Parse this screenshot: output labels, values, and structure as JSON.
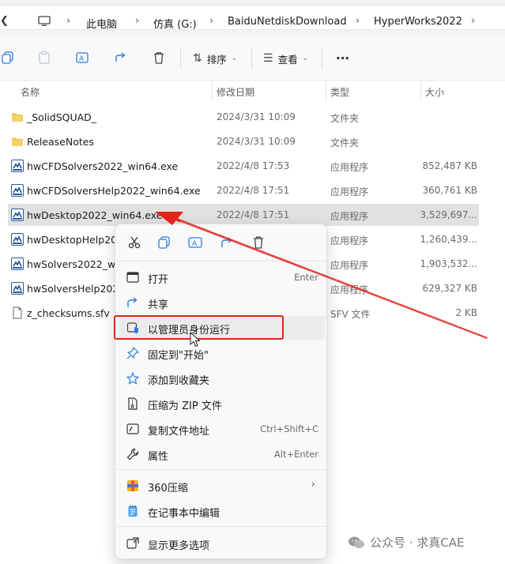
{
  "breadcrumb": [
    "此电脑",
    "仿真 (G:)",
    "BaiduNetdiskDownload",
    "HyperWorks2022"
  ],
  "toolbar": {
    "sort_label": "排序",
    "view_label": "查看",
    "more_label": "···"
  },
  "columns": {
    "name": "名称",
    "date": "修改日期",
    "type": "类型",
    "size": "大小"
  },
  "files": [
    {
      "name": "_SolidSQUAD_",
      "date": "2024/3/31 10:09",
      "type": "文件夹",
      "size": "",
      "icon": "folder"
    },
    {
      "name": "ReleaseNotes",
      "date": "2024/3/31 10:09",
      "type": "文件夹",
      "size": "",
      "icon": "folder"
    },
    {
      "name": "hwCFDSolvers2022_win64.exe",
      "date": "2022/4/8 17:53",
      "type": "应用程序",
      "size": "852,487 KB",
      "icon": "exe"
    },
    {
      "name": "hwCFDSolversHelp2022_win64.exe",
      "date": "2022/4/8 17:51",
      "type": "应用程序",
      "size": "360,761 KB",
      "icon": "exe"
    },
    {
      "name": "hwDesktop2022_win64.exe",
      "date": "2022/4/8 17:51",
      "type": "应用程序",
      "size": "3,529,697...",
      "icon": "exe"
    },
    {
      "name": "hwDesktopHelp202",
      "date": "",
      "type": "应用程序",
      "size": "1,260,439...",
      "icon": "exe"
    },
    {
      "name": "hwSolvers2022_win",
      "date": "",
      "type": "应用程序",
      "size": "1,903,532...",
      "icon": "exe"
    },
    {
      "name": "hwSolversHelp202",
      "date": "",
      "type": "应用程序",
      "size": "629,327 KB",
      "icon": "exe"
    },
    {
      "name": "z_checksums.sfv",
      "date": "",
      "type": "SFV 文件",
      "size": "2 KB",
      "icon": "file"
    }
  ],
  "context_menu": {
    "items": [
      {
        "label": "打开",
        "shortcut": "Enter",
        "icon": "open-icon"
      },
      {
        "label": "共享",
        "shortcut": "",
        "icon": "share-icon"
      },
      {
        "label": "以管理员身份运行",
        "shortcut": "",
        "icon": "shield-icon"
      },
      {
        "label": "固定到\"开始\"",
        "shortcut": "",
        "icon": "pin-icon"
      },
      {
        "label": "添加到收藏夹",
        "shortcut": "",
        "icon": "star-icon"
      },
      {
        "label": "压缩为 ZIP 文件",
        "shortcut": "",
        "icon": "zip-icon"
      },
      {
        "label": "复制文件地址",
        "shortcut": "Ctrl+Shift+C",
        "icon": "copy-path-icon"
      },
      {
        "label": "属性",
        "shortcut": "Alt+Enter",
        "icon": "wrench-icon"
      },
      {
        "label": "360压缩",
        "shortcut": "",
        "icon": "archive-360-icon"
      },
      {
        "label": "在记事本中编辑",
        "shortcut": "",
        "icon": "notepad-icon"
      },
      {
        "label": "显示更多选项",
        "shortcut": "",
        "icon": "more-options-icon"
      }
    ]
  },
  "watermark": "公众号 · 求真CAE",
  "colors": {
    "annotation": "#e1251b",
    "folder": "#f2c14e",
    "selected_row": "#e1e1e1"
  }
}
